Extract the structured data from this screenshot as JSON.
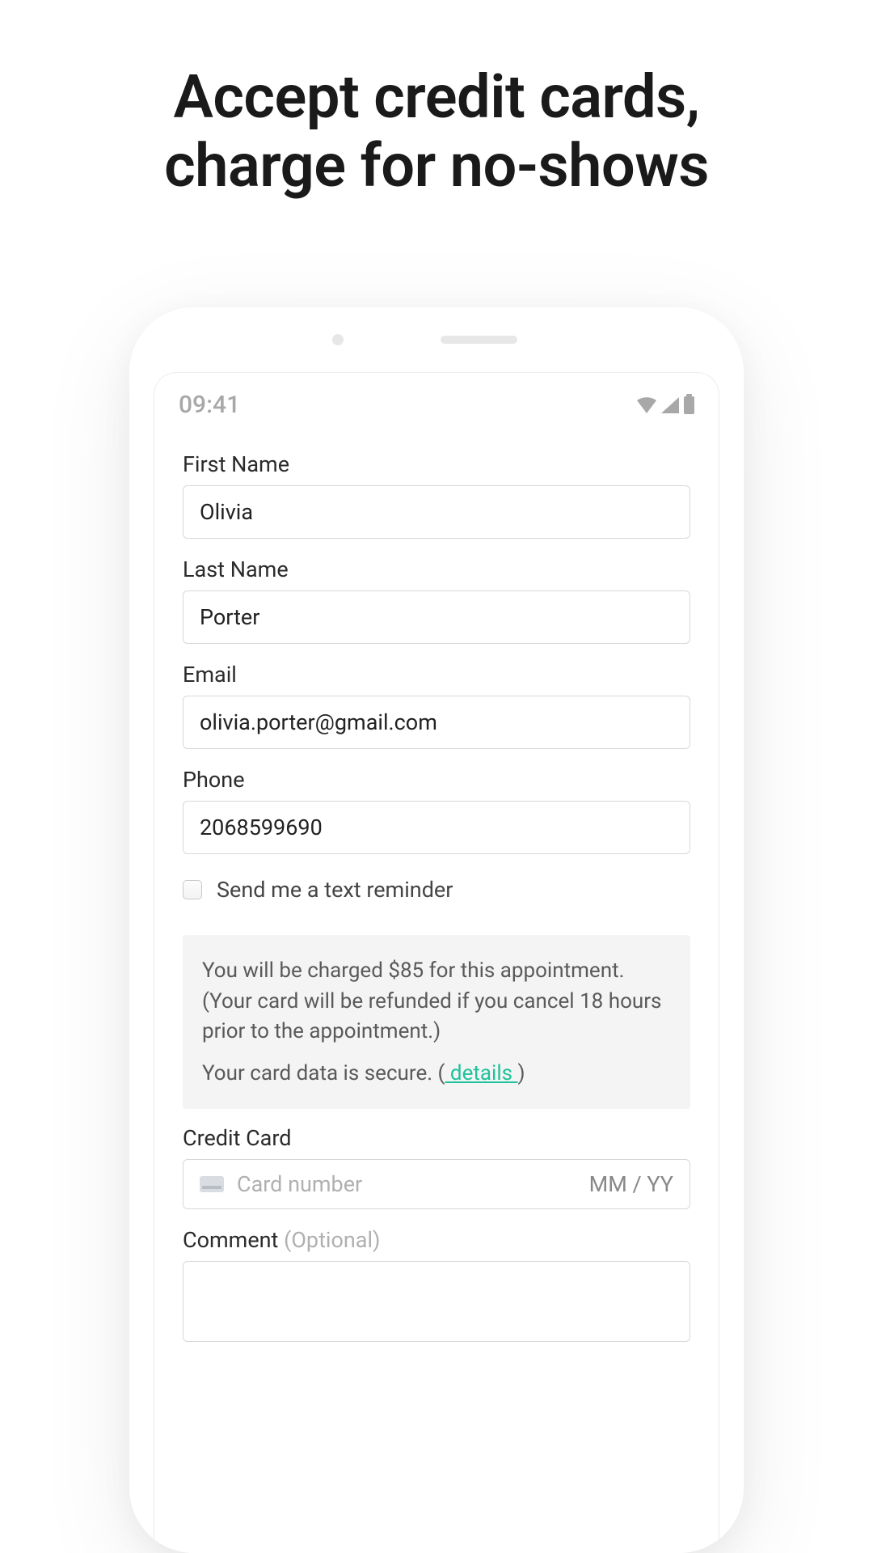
{
  "headline_line1": "Accept credit cards,",
  "headline_line2": "charge for no-shows",
  "status": {
    "time": "09:41"
  },
  "form": {
    "first_name_label": "First Name",
    "first_name_value": "Olivia",
    "last_name_label": "Last Name",
    "last_name_value": "Porter",
    "email_label": "Email",
    "email_value": "olivia.porter@gmail.com",
    "phone_label": "Phone",
    "phone_value": "2068599690",
    "checkbox_label": "Send me a text reminder",
    "info_line1": "You will be charged $85 for this appointment. (Your card will be refunded if you cancel 18 hours prior to the appointment.)",
    "info_line2_prefix": "Your card data is secure. (",
    "info_link": " details ",
    "info_line2_suffix": ")",
    "cc_label": "Credit Card",
    "cc_placeholder": "Card number",
    "cc_exp_placeholder": "MM / YY",
    "comment_label": "Comment ",
    "comment_optional": "(Optional)"
  }
}
